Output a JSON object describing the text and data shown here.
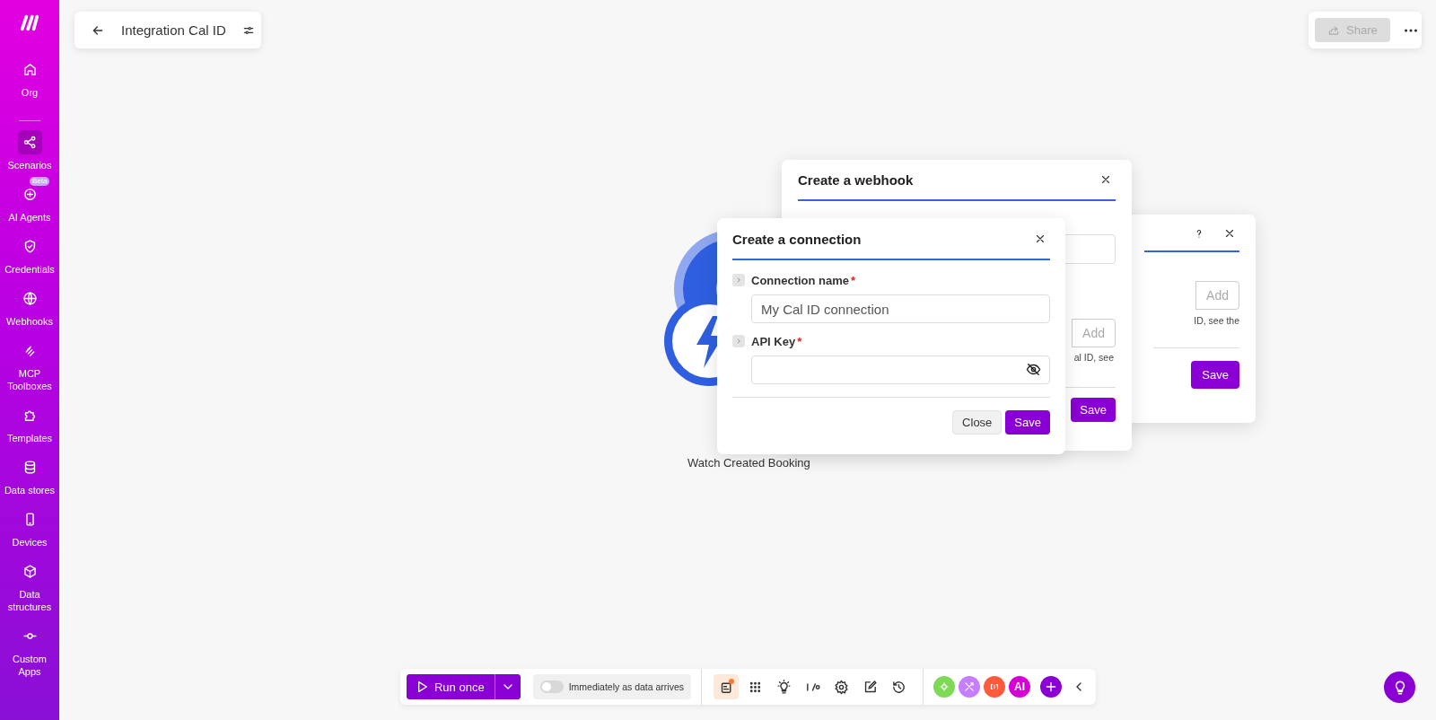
{
  "sidebar": {
    "items": [
      {
        "label": "Org",
        "selected": false
      },
      {
        "label": "Scenarios",
        "selected": true
      },
      {
        "label": "AI Agents",
        "selected": false,
        "badge": "Beta"
      },
      {
        "label": "Credentials",
        "selected": false
      },
      {
        "label": "Webhooks",
        "selected": false
      },
      {
        "label": "MCP Toolboxes",
        "selected": false
      },
      {
        "label": "Templates",
        "selected": false
      },
      {
        "label": "Data stores",
        "selected": false
      },
      {
        "label": "Devices",
        "selected": false
      },
      {
        "label": "Data structures",
        "selected": false
      },
      {
        "label": "Custom Apps",
        "selected": false
      }
    ]
  },
  "scenario": {
    "title": "Integration Cal ID"
  },
  "share_button": {
    "label": "Share",
    "disabled": true
  },
  "module": {
    "label": "Watch Created Booking"
  },
  "back_dialog": {
    "add_button": "Add",
    "hint": "ID, see the",
    "save_button": "Save"
  },
  "webhook_dialog": {
    "title": "Create a webhook",
    "add_button": "Add",
    "hint": "al ID, see",
    "save_button": "Save"
  },
  "connection_dialog": {
    "title": "Create a connection",
    "fields": [
      {
        "label": "Connection name",
        "required_mark": "*",
        "value": "My Cal ID connection",
        "masked": false
      },
      {
        "label": "API Key",
        "required_mark": "*",
        "masked": true
      }
    ],
    "buttons": [
      {
        "label": "Close",
        "kind": "secondary"
      },
      {
        "label": "Save",
        "kind": "primary"
      }
    ]
  },
  "toolbar": {
    "run_button": "Run once",
    "schedule": {
      "label": "Immediately as data arrives",
      "on": false
    },
    "tools": [
      {
        "selected": true
      },
      {
        "selected": false
      },
      {
        "selected": false
      },
      {
        "selected": false
      },
      {
        "selected": false
      },
      {
        "selected": false
      },
      {
        "selected": false
      }
    ],
    "apps": [
      {
        "color": "#7ed957"
      },
      {
        "color": "#c77dff"
      },
      {
        "color": "#ff5a3c"
      },
      {
        "color": "#d600d6",
        "text": "AI"
      }
    ]
  }
}
